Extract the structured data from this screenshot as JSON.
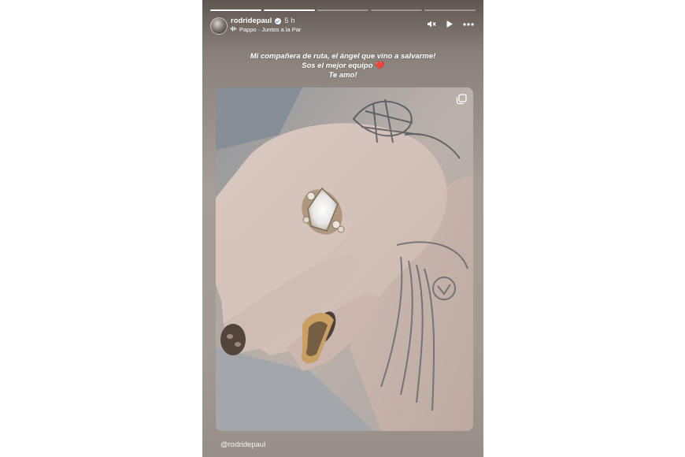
{
  "story": {
    "progress_segments": 5,
    "progress_done": 2,
    "header": {
      "username": "rodridepaul",
      "time": "5 h",
      "music": "Pappo · Juntos a la Par",
      "icons": [
        "mute-icon",
        "play-icon",
        "more-icon"
      ]
    },
    "caption": {
      "line1": "Mi compañera de ruta, el ángel que vino a salvarme!",
      "line2": "Sos el mejor equipo",
      "line3": "Te amo!",
      "heart_glyph": "❤️"
    },
    "photo": {
      "icon": "multiple-photos-icon"
    },
    "footer_handle": "@rodridepaul"
  },
  "colors": {
    "background": "#ffffff",
    "story_bg": "#a59d96",
    "heart": "#e0202c",
    "text": "#ffffff"
  }
}
